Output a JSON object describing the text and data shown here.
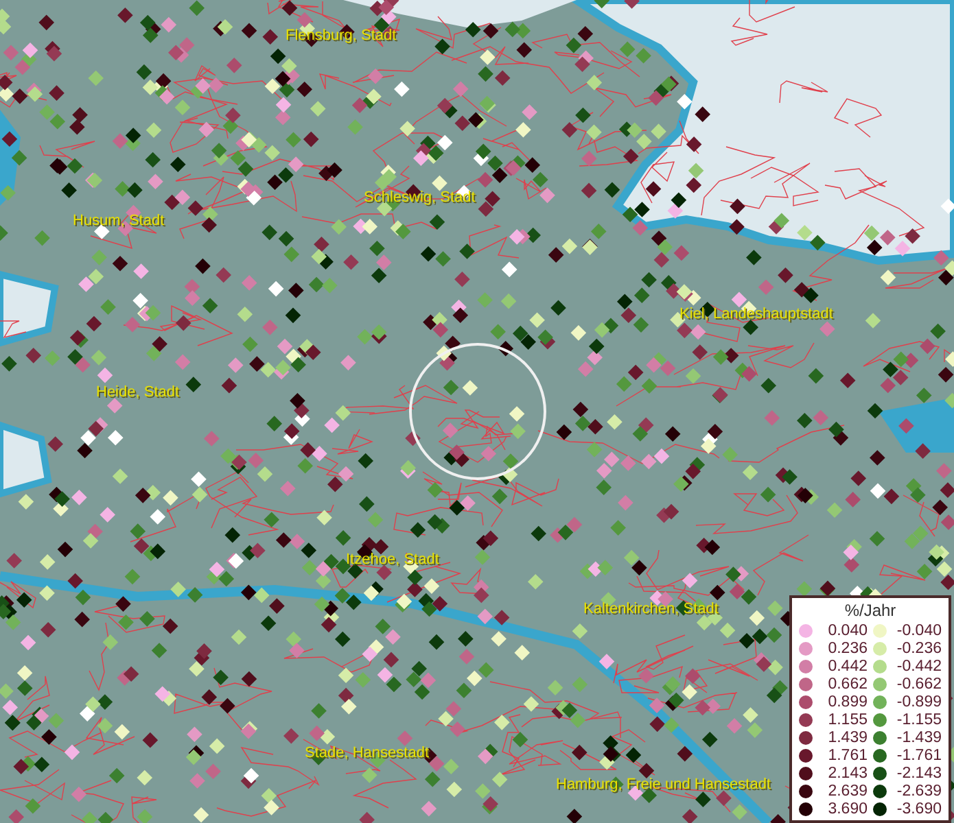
{
  "map": {
    "places": [
      {
        "name": "Flensburg, Stadt"
      },
      {
        "name": "Schleswig, Stadt"
      },
      {
        "name": "Husum, Stadt"
      },
      {
        "name": "Kiel, Landeshauptstadt"
      },
      {
        "name": "Heide, Stadt"
      },
      {
        "name": "Itzehoe, Stadt"
      },
      {
        "name": "Kaltenkirchen, Stadt"
      },
      {
        "name": "Stade, Hansestadt"
      },
      {
        "name": "Hamburg, Freie und Hansestadt"
      }
    ]
  },
  "legend": {
    "title": "%/Jahr",
    "positive": [
      {
        "label": "0.040",
        "color": "#f4b4e4"
      },
      {
        "label": "0.236",
        "color": "#e49ac4"
      },
      {
        "label": "0.442",
        "color": "#d27ea6"
      },
      {
        "label": "0.662",
        "color": "#c06688"
      },
      {
        "label": "0.899",
        "color": "#ac4c6c"
      },
      {
        "label": "1.155",
        "color": "#943a54"
      },
      {
        "label": "1.439",
        "color": "#7e2a40"
      },
      {
        "label": "1.761",
        "color": "#68182c"
      },
      {
        "label": "2.143",
        "color": "#500e1c"
      },
      {
        "label": "2.639",
        "color": "#3a0610"
      },
      {
        "label": "3.690",
        "color": "#240006"
      }
    ],
    "negative": [
      {
        "label": "-0.040",
        "color": "#f0f6c4"
      },
      {
        "label": "-0.236",
        "color": "#d6eca8"
      },
      {
        "label": "-0.442",
        "color": "#b4dc8c"
      },
      {
        "label": "-0.662",
        "color": "#94c874"
      },
      {
        "label": "-0.899",
        "color": "#72b25a"
      },
      {
        "label": "-1.155",
        "color": "#54983e"
      },
      {
        "label": "-1.439",
        "color": "#3c8030"
      },
      {
        "label": "-1.761",
        "color": "#286820"
      },
      {
        "label": "-2.143",
        "color": "#185016"
      },
      {
        "label": "-2.639",
        "color": "#0c3a0c"
      },
      {
        "label": "-3.690",
        "color": "#042404"
      }
    ]
  }
}
